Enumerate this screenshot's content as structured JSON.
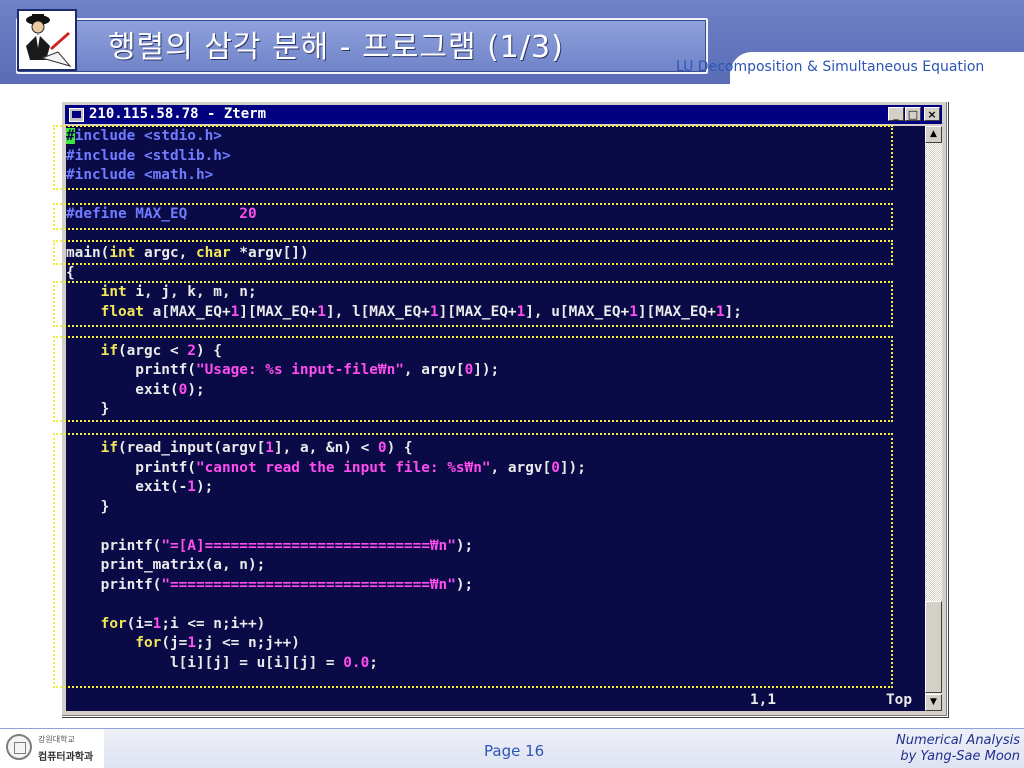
{
  "slide": {
    "title": "행렬의 삼각 분해 - 프로그램 (1/3)",
    "subtitle": "LU Decomposition & Simultaneous Equation",
    "page": "Page 16",
    "course": "Numerical Analysis",
    "author": "by Yang-Sae Moon",
    "univ_name": "강원대학교",
    "dept_name": "컴퓨터과학과"
  },
  "window": {
    "title": "210.115.58.78 - Zterm",
    "minimize_label": "_",
    "maximize_label": "□",
    "close_label": "×"
  },
  "terminal": {
    "status_position": "1,1",
    "status_scroll": "Top",
    "lines": [
      {
        "segments": [
          {
            "text": "#",
            "cls": "cursor"
          },
          {
            "text": "include <stdio.h>",
            "cls": "c-pre"
          }
        ]
      },
      {
        "segments": [
          {
            "text": "#include <stdlib.h>",
            "cls": "c-pre"
          }
        ]
      },
      {
        "segments": [
          {
            "text": "#include <math.h>",
            "cls": "c-pre"
          }
        ]
      },
      {
        "segments": []
      },
      {
        "segments": [
          {
            "text": "#define MAX_EQ      ",
            "cls": "c-pre"
          },
          {
            "text": "20",
            "cls": "c-num"
          }
        ]
      },
      {
        "segments": []
      },
      {
        "segments": [
          {
            "text": "main(",
            "cls": ""
          },
          {
            "text": "int",
            "cls": "c-type"
          },
          {
            "text": " argc, ",
            "cls": ""
          },
          {
            "text": "char",
            "cls": "c-type"
          },
          {
            "text": " *argv[])",
            "cls": ""
          }
        ]
      },
      {
        "segments": [
          {
            "text": "{",
            "cls": ""
          }
        ]
      },
      {
        "segments": [
          {
            "text": "    ",
            "cls": ""
          },
          {
            "text": "int",
            "cls": "c-type"
          },
          {
            "text": " i, j, k, m, n;",
            "cls": ""
          }
        ]
      },
      {
        "segments": [
          {
            "text": "    ",
            "cls": ""
          },
          {
            "text": "float",
            "cls": "c-type"
          },
          {
            "text": " a[MAX_EQ+",
            "cls": ""
          },
          {
            "text": "1",
            "cls": "c-num"
          },
          {
            "text": "][MAX_EQ+",
            "cls": ""
          },
          {
            "text": "1",
            "cls": "c-num"
          },
          {
            "text": "], l[MAX_EQ+",
            "cls": ""
          },
          {
            "text": "1",
            "cls": "c-num"
          },
          {
            "text": "][MAX_EQ+",
            "cls": ""
          },
          {
            "text": "1",
            "cls": "c-num"
          },
          {
            "text": "], u[MAX_EQ+",
            "cls": ""
          },
          {
            "text": "1",
            "cls": "c-num"
          },
          {
            "text": "][MAX_EQ+",
            "cls": ""
          },
          {
            "text": "1",
            "cls": "c-num"
          },
          {
            "text": "];",
            "cls": ""
          }
        ]
      },
      {
        "segments": []
      },
      {
        "segments": [
          {
            "text": "    ",
            "cls": ""
          },
          {
            "text": "if",
            "cls": "c-kw"
          },
          {
            "text": "(argc < ",
            "cls": ""
          },
          {
            "text": "2",
            "cls": "c-num"
          },
          {
            "text": ") {",
            "cls": ""
          }
        ]
      },
      {
        "segments": [
          {
            "text": "        printf(",
            "cls": ""
          },
          {
            "text": "\"Usage: %s input-file₩n\"",
            "cls": "c-str"
          },
          {
            "text": ", argv[",
            "cls": ""
          },
          {
            "text": "0",
            "cls": "c-num"
          },
          {
            "text": "]);",
            "cls": ""
          }
        ]
      },
      {
        "segments": [
          {
            "text": "        exit(",
            "cls": ""
          },
          {
            "text": "0",
            "cls": "c-num"
          },
          {
            "text": ");",
            "cls": ""
          }
        ]
      },
      {
        "segments": [
          {
            "text": "    }",
            "cls": ""
          }
        ]
      },
      {
        "segments": []
      },
      {
        "segments": [
          {
            "text": "    ",
            "cls": ""
          },
          {
            "text": "if",
            "cls": "c-kw"
          },
          {
            "text": "(read_input(argv[",
            "cls": ""
          },
          {
            "text": "1",
            "cls": "c-num"
          },
          {
            "text": "], a, &n) < ",
            "cls": ""
          },
          {
            "text": "0",
            "cls": "c-num"
          },
          {
            "text": ") {",
            "cls": ""
          }
        ]
      },
      {
        "segments": [
          {
            "text": "        printf(",
            "cls": ""
          },
          {
            "text": "\"cannot read the input file: %s₩n\"",
            "cls": "c-str"
          },
          {
            "text": ", argv[",
            "cls": ""
          },
          {
            "text": "0",
            "cls": "c-num"
          },
          {
            "text": "]);",
            "cls": ""
          }
        ]
      },
      {
        "segments": [
          {
            "text": "        exit(-",
            "cls": ""
          },
          {
            "text": "1",
            "cls": "c-num"
          },
          {
            "text": ");",
            "cls": ""
          }
        ]
      },
      {
        "segments": [
          {
            "text": "    }",
            "cls": ""
          }
        ]
      },
      {
        "segments": []
      },
      {
        "segments": [
          {
            "text": "    printf(",
            "cls": ""
          },
          {
            "text": "\"=[A]==========================₩n\"",
            "cls": "c-str"
          },
          {
            "text": ");",
            "cls": ""
          }
        ]
      },
      {
        "segments": [
          {
            "text": "    print_matrix(a, n);",
            "cls": ""
          }
        ]
      },
      {
        "segments": [
          {
            "text": "    printf(",
            "cls": ""
          },
          {
            "text": "\"==============================₩n\"",
            "cls": "c-str"
          },
          {
            "text": ");",
            "cls": ""
          }
        ]
      },
      {
        "segments": []
      },
      {
        "segments": [
          {
            "text": "    ",
            "cls": ""
          },
          {
            "text": "for",
            "cls": "c-kw"
          },
          {
            "text": "(i=",
            "cls": ""
          },
          {
            "text": "1",
            "cls": "c-num"
          },
          {
            "text": ";i <= n;i++)",
            "cls": ""
          }
        ]
      },
      {
        "segments": [
          {
            "text": "        ",
            "cls": ""
          },
          {
            "text": "for",
            "cls": "c-kw"
          },
          {
            "text": "(j=",
            "cls": ""
          },
          {
            "text": "1",
            "cls": "c-num"
          },
          {
            "text": ";j <= n;j++)",
            "cls": ""
          }
        ]
      },
      {
        "segments": [
          {
            "text": "            l[i][j] = u[i][j] = ",
            "cls": ""
          },
          {
            "text": "0.0",
            "cls": "c-num"
          },
          {
            "text": ";",
            "cls": ""
          }
        ]
      }
    ]
  }
}
